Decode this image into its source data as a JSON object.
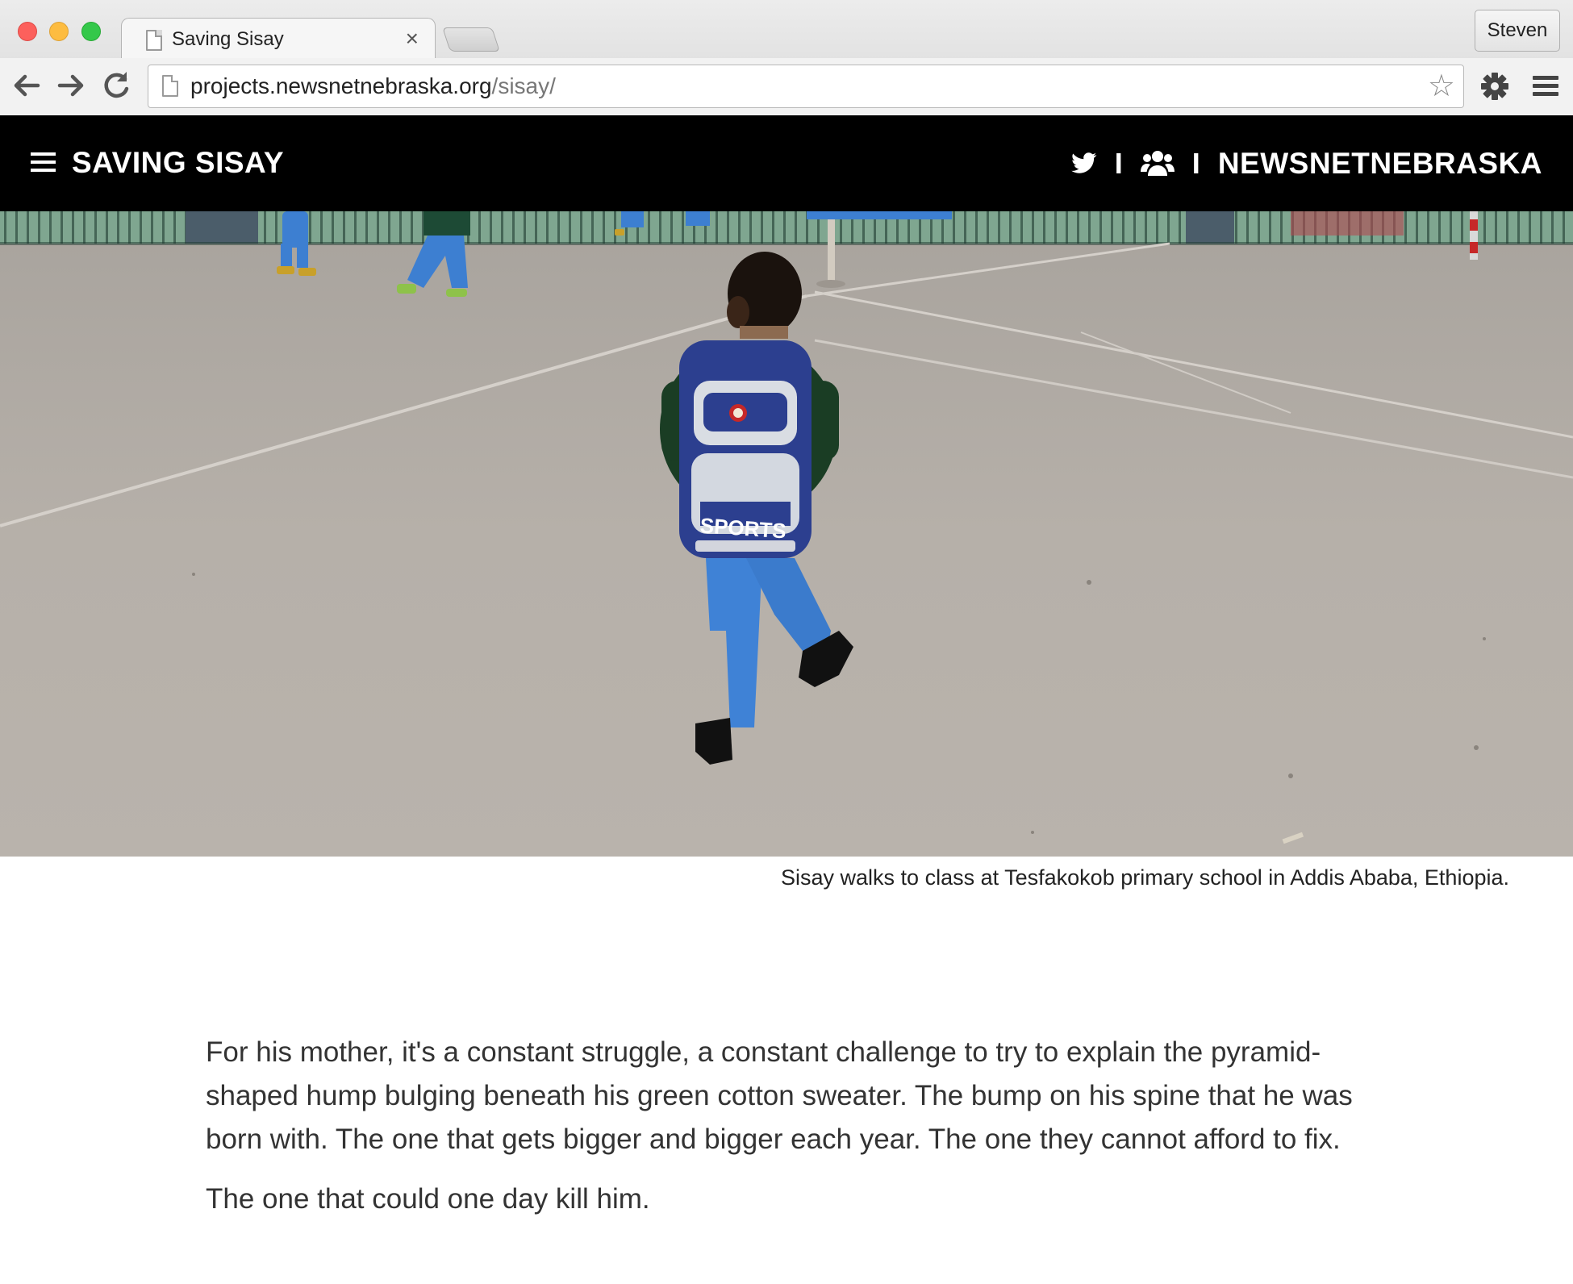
{
  "browser": {
    "tab_title": "Saving Sisay",
    "tab_close": "×",
    "profile_name": "Steven",
    "url_host": "projects.newsnetnebraska.org",
    "url_path": "/sisay/"
  },
  "site": {
    "title": "SAVING SISAY",
    "separator": "I",
    "brand": "NEWSNETNEBRASKA",
    "icons": [
      "menu-icon",
      "twitter-icon",
      "group-icon"
    ]
  },
  "hero": {
    "backpack_text": "SPORTS",
    "caption": "Sisay walks to class at Tesfakokob primary school in Addis Ababa, Ethiopia."
  },
  "article": {
    "paragraphs": [
      "For his mother, it's a constant struggle, a constant challenge to try to explain the pyramid-shaped hump bulging beneath his green cotton sweater. The bump on his spine that he was born with. The one that gets bigger and bigger each year. The one they cannot afford to fix.",
      "The one that could one day kill him."
    ]
  },
  "colors": {
    "header_bg": "#000000",
    "header_text": "#ffffff",
    "body_text": "#333333",
    "ground": "#b3ada6"
  }
}
